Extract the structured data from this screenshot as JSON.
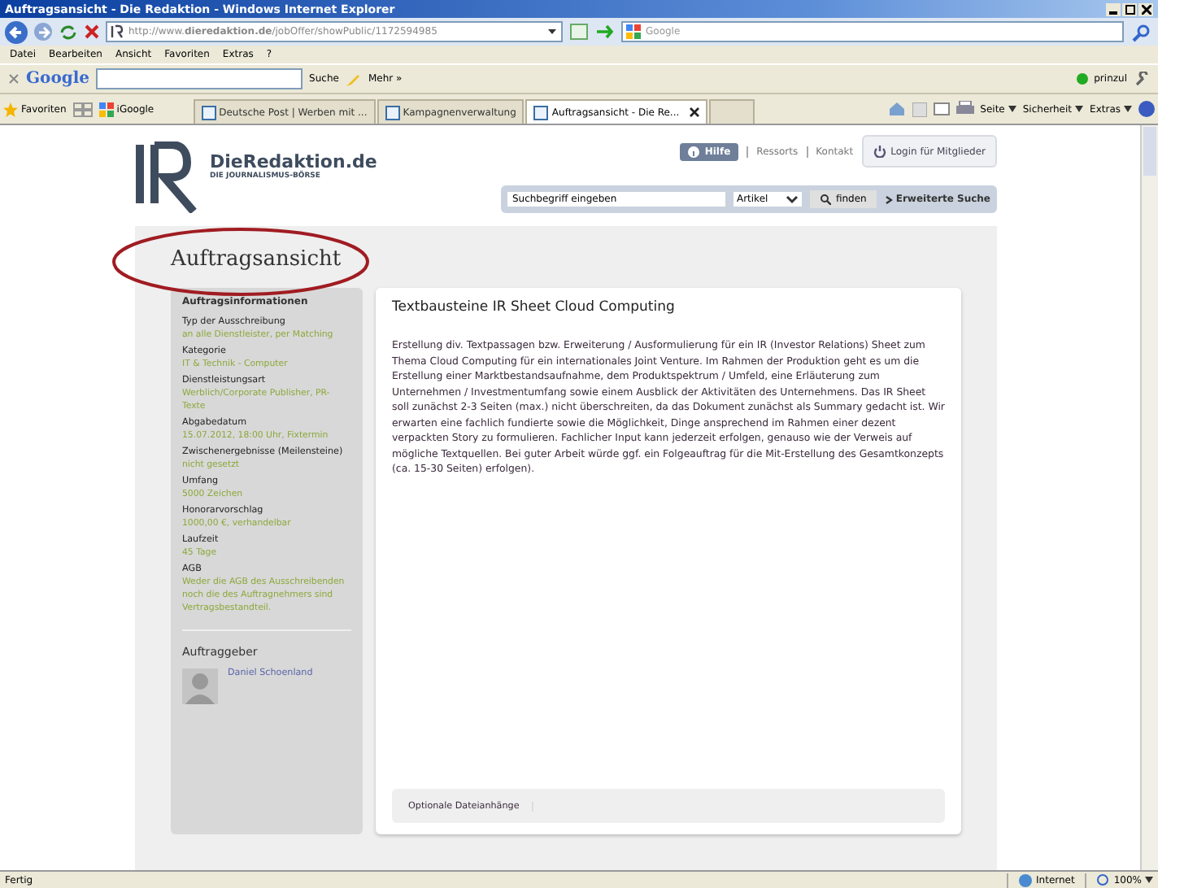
{
  "window": {
    "title": "Auftragsansicht - Die Redaktion - Windows Internet Explorer"
  },
  "address_bar": {
    "url": "http://www.**dieredaktion.de**/jobOffer/showPublic/1172594985",
    "search_placeholder": "Google"
  },
  "menu": [
    "Datei",
    "Bearbeiten",
    "Ansicht",
    "Favoriten",
    "Extras",
    "?"
  ],
  "google_toolbar": {
    "brand": "Google",
    "search_button": "Suche",
    "more": "Mehr »",
    "user": "prinzul"
  },
  "favorites_bar": {
    "label": "Favoriten",
    "link": "iGoogle"
  },
  "tabs": [
    {
      "label": "Deutsche Post | Werben mit ...",
      "selected": false
    },
    {
      "label": "Kampagnenverwaltung",
      "selected": false
    },
    {
      "label": "Auftragsansicht - Die Re...",
      "selected": true
    }
  ],
  "command_bar": [
    "Seite",
    "Sicherheit",
    "Extras"
  ],
  "site": {
    "logo": "DieRedaktion.de",
    "tagline": "DIE JOURNALISMUS-BÖRSE",
    "help": "Hilfe",
    "links": [
      "Ressorts",
      "Kontakt"
    ],
    "login": "Login für Mitglieder",
    "search": {
      "value": "Suchbegriff eingeben",
      "category": "Artikel",
      "button": "finden",
      "advanced": "Erweiterte Suche"
    }
  },
  "page_title": "Auftragsansicht",
  "sidebar": {
    "heading": "Auftragsinformationen",
    "fields": [
      {
        "label": "Typ der Ausschreibung",
        "value": "an alle Dienstleister, per Matching"
      },
      {
        "label": "Kategorie",
        "value": "IT & Technik - Computer"
      },
      {
        "label": "Dienstleistungsart",
        "value": "Werblich/Corporate Publisher, PR-Texte"
      },
      {
        "label": "Abgabedatum",
        "value": "15.07.2012, 18:00 Uhr, Fixtermin"
      },
      {
        "label": "Zwischenergebnisse (Meilensteine)",
        "value": "nicht gesetzt"
      },
      {
        "label": "Umfang",
        "value": "5000 Zeichen"
      },
      {
        "label": "Honorarvorschlag",
        "value": "1000,00 €, verhandelbar"
      },
      {
        "label": "Laufzeit",
        "value": "45 Tage"
      },
      {
        "label": "AGB",
        "value": "Weder die AGB des Ausschreibenden noch die des Auftragnehmers sind Vertragsbestandteil."
      }
    ],
    "client_heading": "Auftraggeber",
    "client_name": "Daniel Schoenland"
  },
  "main": {
    "title": "Textbausteine IR Sheet Cloud Computing",
    "body": "Erstellung div. Textpassagen bzw. Erweiterung / Ausformulierung für ein IR (Investor Relations) Sheet zum Thema Cloud Computing für ein internationales Joint Venture. Im Rahmen der Produktion geht es um die Erstellung einer Marktbestandsaufnahme, dem Produktspektrum / Umfeld, eine Erläuterung zum Unternehmen / Investmentumfang sowie einem Ausblick der Aktivitäten des Unternehmens. Das IR Sheet soll zunächst 2-3 Seiten (max.) nicht überschreiten, da das Dokument zunächst als Summary gedacht ist. Wir erwarten eine fachlich fundierte sowie die Möglichkeit, Dinge ansprechend im Rahmen einer dezent verpackten Story zu formulieren. Fachlicher Input kann jederzeit erfolgen, genauso wie der Verweis auf mögliche Textquellen. Bei guter Arbeit würde ggf. ein Folgeauftrag für die Mit-Erstellung des Gesamtkonzepts (ca. 15-30 Seiten) erfolgen).",
    "attachments": "Optionale Dateianhänge"
  },
  "status_bar": {
    "text": "Fertig",
    "zone": "Internet",
    "zoom": "100%"
  }
}
